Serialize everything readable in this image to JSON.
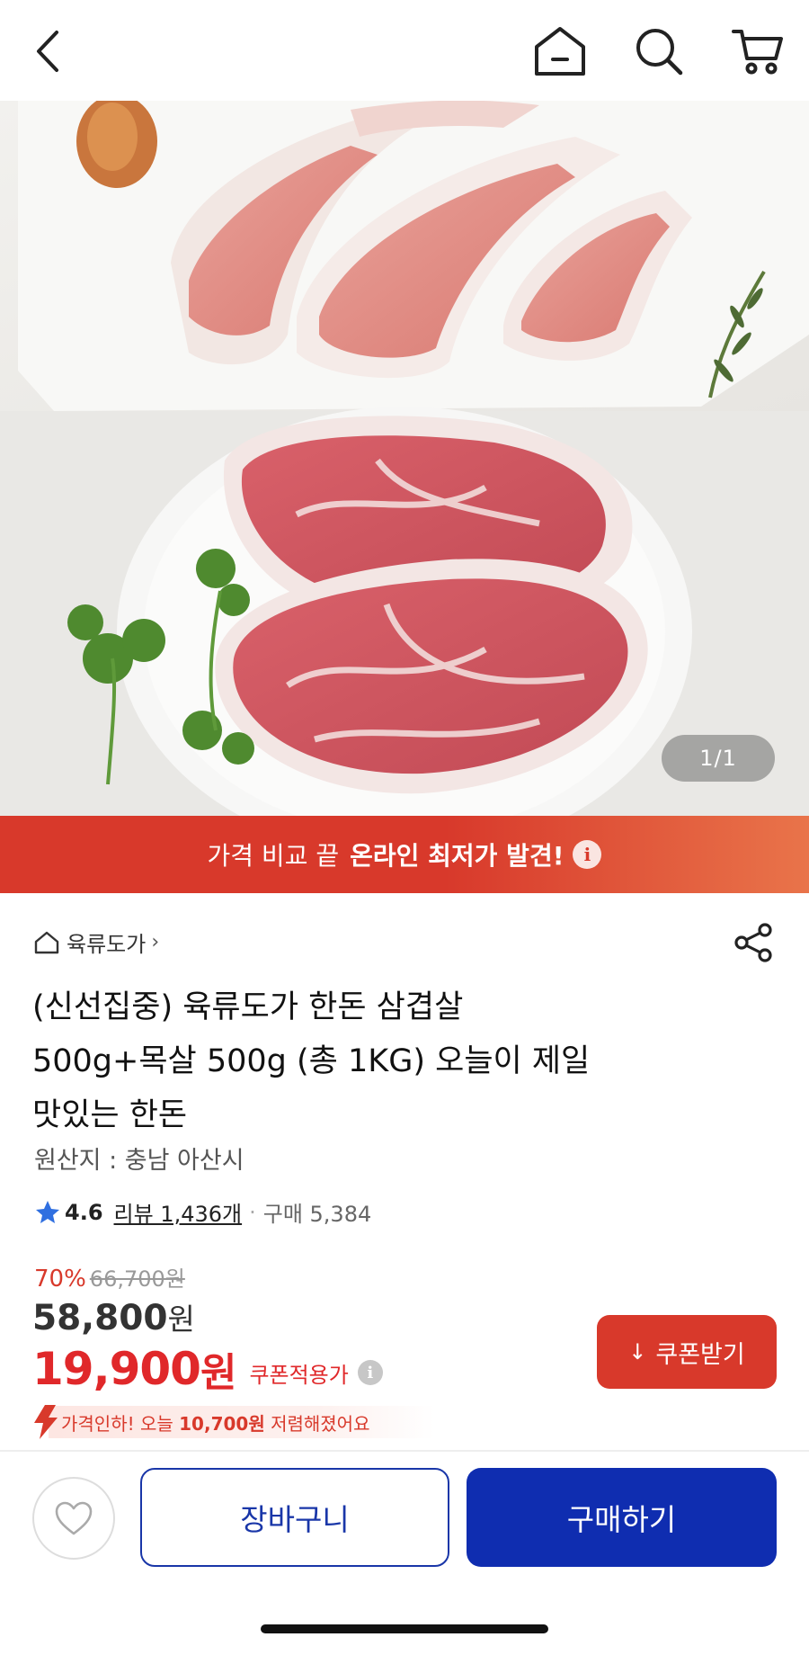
{
  "header": {
    "back_icon": "chevron-left-icon",
    "home_icon": "home-icon",
    "search_icon": "search-icon",
    "cart_icon": "cart-icon"
  },
  "hero": {
    "counter": "1/1"
  },
  "promo": {
    "text_regular": "가격 비교 끝",
    "text_bold": "온라인 최저가 발견!",
    "info_glyph": "i",
    "colors": {
      "start": "#d8392b",
      "end": "#e9744a"
    }
  },
  "product": {
    "seller": "육류도가",
    "seller_chevron": "›",
    "title_lines": [
      "(신선집중) 육류도가 한돈 삼겹살",
      "500g+목살 500g (총 1KG) 오늘이 제일",
      "맛있는 한돈"
    ],
    "origin": "원산지 : 충남 아산시",
    "rating": {
      "score": "4.6",
      "reviews": "리뷰 1,436개",
      "separator": "·",
      "purchases": "구매 5,384"
    },
    "price": {
      "discount_pct": "70%",
      "original": "66,700원",
      "sale_value": "58,800",
      "sale_unit": "원",
      "coupon_value": "19,900",
      "coupon_unit": "원",
      "coupon_label": "쿠폰적용가",
      "info_glyph": "i"
    },
    "coupon_button": {
      "arrow": "↓",
      "label": "쿠폰받기"
    },
    "price_drop": {
      "prefix": "가격인하! 오늘",
      "amount": "10,700원",
      "suffix": "저렴해졌어요"
    }
  },
  "bottom_bar": {
    "wish_icon": "heart-icon",
    "cart_label": "장바구니",
    "buy_label": "구매하기",
    "colors": {
      "primary": "#0f2db0",
      "accent_red": "#e0282a"
    }
  }
}
